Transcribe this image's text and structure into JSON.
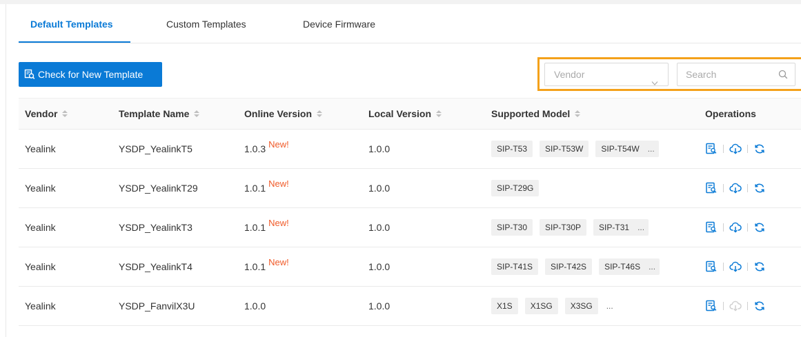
{
  "tabs": [
    {
      "label": "Default Templates",
      "active": true
    },
    {
      "label": "Custom Templates",
      "active": false
    },
    {
      "label": "Device Firmware",
      "active": false
    }
  ],
  "toolbar": {
    "check_button_label": "Check for New Template",
    "vendor_placeholder": "Vendor",
    "search_placeholder": "Search",
    "highlight_color": "#f4a11a",
    "accent_color": "#0a7ad6"
  },
  "table": {
    "columns": [
      "Vendor",
      "Template Name",
      "Online Version",
      "Local Version",
      "Supported Model",
      "Operations"
    ],
    "new_badge": "New!",
    "more_text": "...",
    "rows": [
      {
        "vendor": "Yealink",
        "template": "YSDP_YealinkT5",
        "online": "1.0.3",
        "is_new": true,
        "local": "1.0.0",
        "models": [
          "SIP-T53",
          "SIP-T53W",
          "SIP-T54W"
        ],
        "more": true,
        "download_enabled": true
      },
      {
        "vendor": "Yealink",
        "template": "YSDP_YealinkT29",
        "online": "1.0.1",
        "is_new": true,
        "local": "1.0.0",
        "models": [
          "SIP-T29G"
        ],
        "more": false,
        "download_enabled": true
      },
      {
        "vendor": "Yealink",
        "template": "YSDP_YealinkT3",
        "online": "1.0.1",
        "is_new": true,
        "local": "1.0.0",
        "models": [
          "SIP-T30",
          "SIP-T30P",
          "SIP-T31"
        ],
        "more": true,
        "download_enabled": true
      },
      {
        "vendor": "Yealink",
        "template": "YSDP_YealinkT4",
        "online": "1.0.1",
        "is_new": true,
        "local": "1.0.0",
        "models": [
          "SIP-T41S",
          "SIP-T42S",
          "SIP-T46S"
        ],
        "more": true,
        "download_enabled": true
      },
      {
        "vendor": "Yealink",
        "template": "YSDP_FanvilX3U",
        "online": "1.0.0",
        "is_new": false,
        "local": "1.0.0",
        "models": [
          "X1S",
          "X1SG",
          "X3SG"
        ],
        "more": true,
        "download_enabled": false
      }
    ],
    "operation_icons": [
      "view-details-icon",
      "download-cloud-icon",
      "refresh-icon"
    ]
  }
}
